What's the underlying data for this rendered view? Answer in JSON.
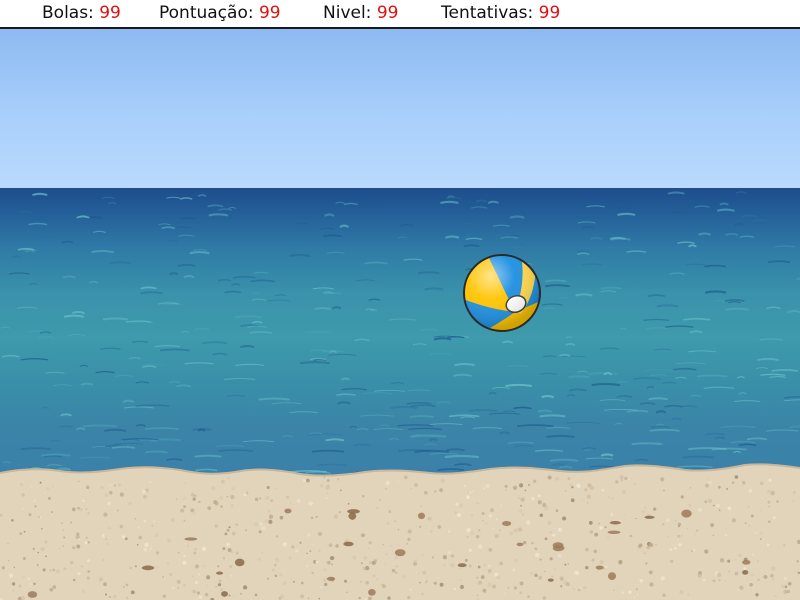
{
  "hud": {
    "balls_label": "Bolas:",
    "balls_value": "99",
    "score_label": "Pontuação:",
    "score_value": "99",
    "level_label": "Nivel:",
    "level_value": "99",
    "tries_label": "Tentativas:",
    "tries_value": "99"
  },
  "colors": {
    "hud_value": "#e01010",
    "sky": "#a9cffb",
    "sea_deep": "#1d4d8c",
    "sea": "#3e9aac",
    "sand": "#e2d3bb",
    "ball_yellow": "#ffc400",
    "ball_blue": "#1e8fe0"
  },
  "scene": {
    "background": "beach",
    "ball_icon": "beach-ball-icon"
  }
}
